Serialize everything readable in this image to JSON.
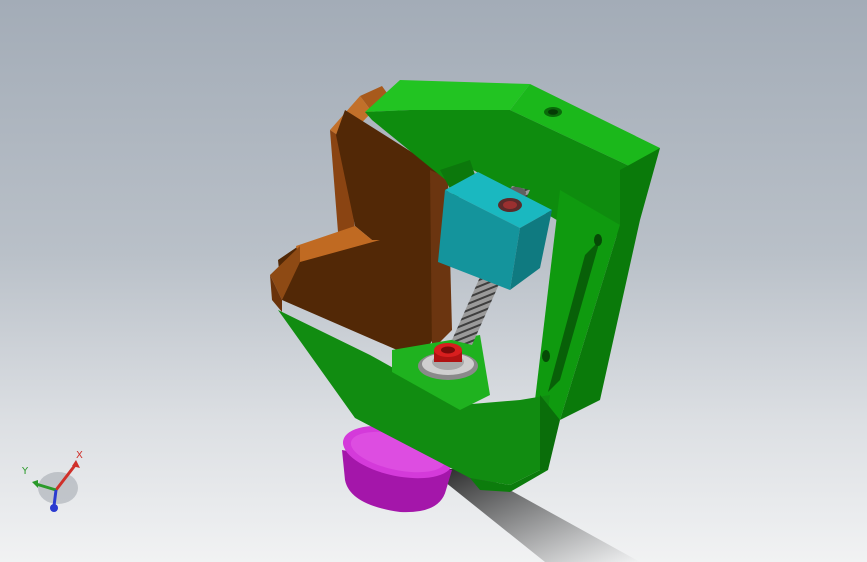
{
  "viewport": {
    "background_top": "#a3acb7",
    "background_bottom": "#f1f2f3"
  },
  "model": {
    "parts": [
      {
        "name": "clamp-frame",
        "color": "#14a814"
      },
      {
        "name": "v-jaw",
        "color": "#7a3a0c"
      },
      {
        "name": "slider-block",
        "color": "#16a0a8"
      },
      {
        "name": "lead-screw",
        "color": "#7a7a7a"
      },
      {
        "name": "nut",
        "color": "#c01818"
      },
      {
        "name": "base-disc",
        "color": "#c020c8"
      }
    ]
  },
  "triad": {
    "x_label": "X",
    "y_label": "Y",
    "x_color": "#d0302a",
    "y_color": "#2a9a2a",
    "z_color": "#2a3ad0"
  }
}
